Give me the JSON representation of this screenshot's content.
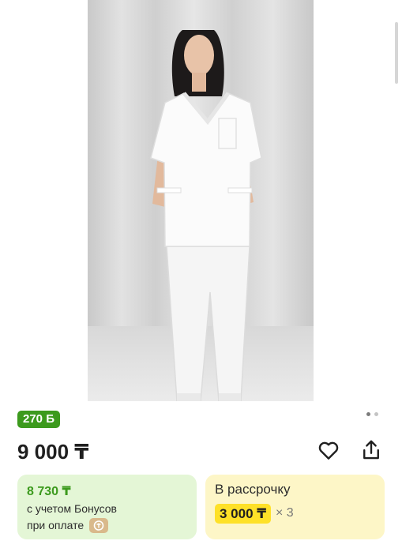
{
  "product": {
    "bonus_badge": "270 Б",
    "price": "9 000 ₸",
    "gallery_dots": 2,
    "gallery_active_dot": 0
  },
  "bonus_card": {
    "price": "8 730 ₸",
    "line1": "с учетом Бонусов",
    "line2": "при оплате"
  },
  "installment_card": {
    "title": "В рассрочку",
    "price": "3 000 ₸",
    "multiplier": "× 3"
  },
  "colors": {
    "bonus_green": "#3c9a1d",
    "bonus_card_bg": "#e4f6d6",
    "installment_card_bg": "#fdf6c7",
    "installment_price_bg": "#fee128"
  }
}
